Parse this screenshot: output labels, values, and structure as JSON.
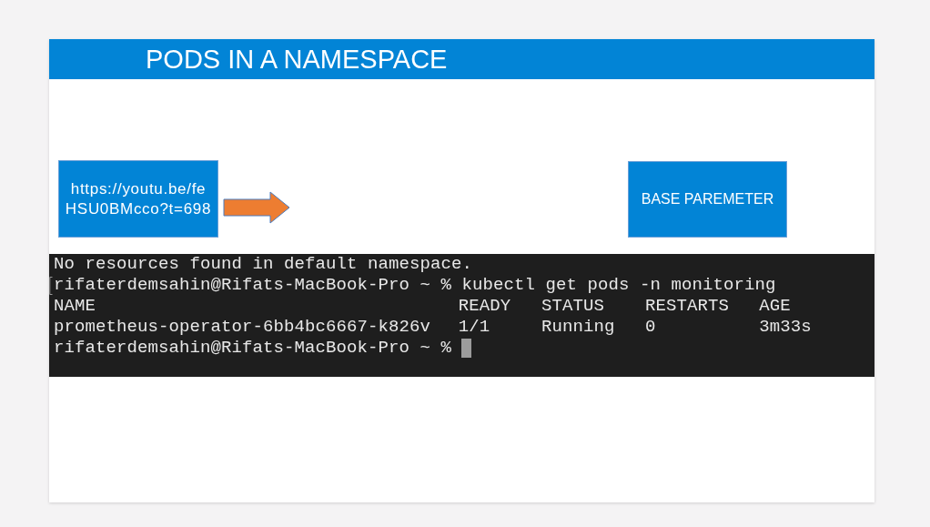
{
  "slide": {
    "title": "PODS IN A NAMESPACE"
  },
  "link_box": {
    "lines": [
      "https://youtu.be/fe",
      "HSU0BMcco?t=698"
    ]
  },
  "label_box": {
    "text": "BASE PAREMETER"
  },
  "terminal": {
    "output_line": "No resources found in default namespace.",
    "prompt": "rifaterdemsahin@Rifats-MacBook-Pro ~ %",
    "command": "kubectl get pods -n monitoring",
    "columns": [
      "NAME",
      "READY",
      "STATUS",
      "RESTARTS",
      "AGE"
    ],
    "rows": [
      [
        "prometheus-operator-6bb4bc6667-k826v",
        "1/1",
        "Running",
        "0",
        "3m33s"
      ]
    ],
    "final_prompt": "rifaterdemsahin@Rifats-MacBook-Pro ~ %"
  }
}
